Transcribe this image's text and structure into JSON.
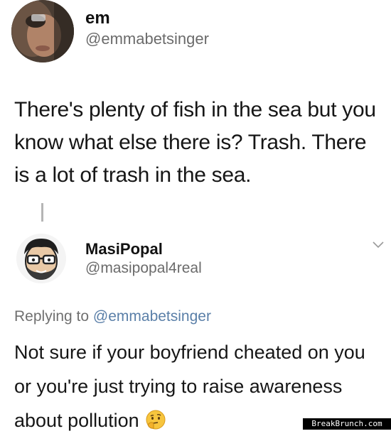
{
  "tweet": {
    "name": "em",
    "handle": "@emmabetsinger",
    "text": "There's plenty of fish in the sea but you know what else there is? Trash. There is a lot of trash in the sea.",
    "avatar_icon": "profile-photo-icon"
  },
  "reply": {
    "name": "MasiPopal",
    "handle": "@masipopal4real",
    "replying_prefix": "Replying to",
    "replying_mention": "@emmabetsinger",
    "text": "Not sure if your boyfriend cheated on you or you're just trying to raise awareness about pollution",
    "emoji_icon": "thinking-face-icon",
    "avatar_icon": "cartoon-avatar-icon",
    "menu_icon": "chevron-down-icon"
  },
  "watermark": {
    "text": "BreakBrunch.com"
  },
  "colors": {
    "text": "#161616",
    "muted": "#6b6b6b",
    "link": "#5a7fa8",
    "thread_line": "#b5b5b5"
  }
}
